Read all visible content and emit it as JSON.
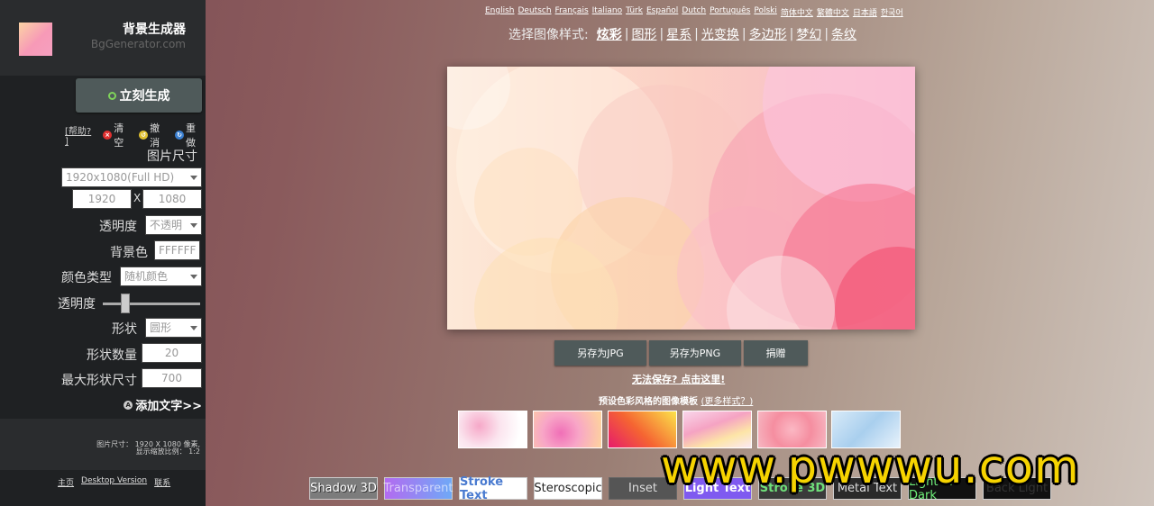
{
  "app": {
    "title": "背景生成器",
    "subtitle": "BgGenerator.com"
  },
  "sidebar": {
    "generate_label": "立刻生成",
    "help_label": "[帮助? ]",
    "actions": [
      {
        "label": "清空",
        "icon": "clear-icon",
        "color": "#e03030"
      },
      {
        "label": "撤消",
        "icon": "undo-icon",
        "color": "#e0c030"
      },
      {
        "label": "重做",
        "icon": "redo-icon",
        "color": "#3a7fd0"
      }
    ],
    "size_heading": "图片尺寸",
    "size_preset": "1920x1080(Full HD)",
    "width": "1920",
    "size_x": "X",
    "height": "1080",
    "transparency_label": "透明度",
    "transparency_value": "不透明",
    "bg_color_label": "背景色",
    "bg_color_value": "FFFFFF",
    "color_type_label": "颜色类型",
    "color_type_value": "随机颜色",
    "opacity_label": "透明度",
    "opacity_level": 0.2,
    "shape_label": "形状",
    "shape_value": "圆形",
    "shape_count_label": "形状数量",
    "shape_count_value": "20",
    "max_shape_label": "最大形状尺寸",
    "max_shape_value": "700",
    "add_text_label": "添加文字>>",
    "info_line1": "图片尺寸： 1920 X 1080 像素,",
    "info_line2": "显示缩放比例： 1:2",
    "footer": [
      "主页",
      "Desktop Version",
      "联系"
    ]
  },
  "languages": [
    "English",
    "Deutsch",
    "Français",
    "Italiano",
    "Türk",
    "Español",
    "Dutch",
    "Português",
    "Polski",
    "简体中文",
    "繁體中文",
    "日本語",
    "한국어"
  ],
  "style_selector": {
    "label": "选择图像样式:",
    "options": [
      "炫彩",
      "图形",
      "星系",
      "光变换",
      "多边形",
      "梦幻",
      "条纹"
    ],
    "active": "炫彩"
  },
  "buttons": {
    "save_jpg": "另存为JPG",
    "save_png": "另存为PNG",
    "donate": "捐赠"
  },
  "cant_save": "无法保存? 点击这里!",
  "preset": {
    "title": "预设色彩风格的图像模板",
    "more": "(更多样式？)"
  },
  "text_styles": [
    "Shadow 3D",
    "Transparent",
    "Stroke Text",
    "Steroscopic",
    "Inset",
    "Light Text",
    "Stroke 3D",
    "Metal Text",
    "Light In Dark",
    "Back Light"
  ],
  "watermark": "www.pwwwu.com"
}
